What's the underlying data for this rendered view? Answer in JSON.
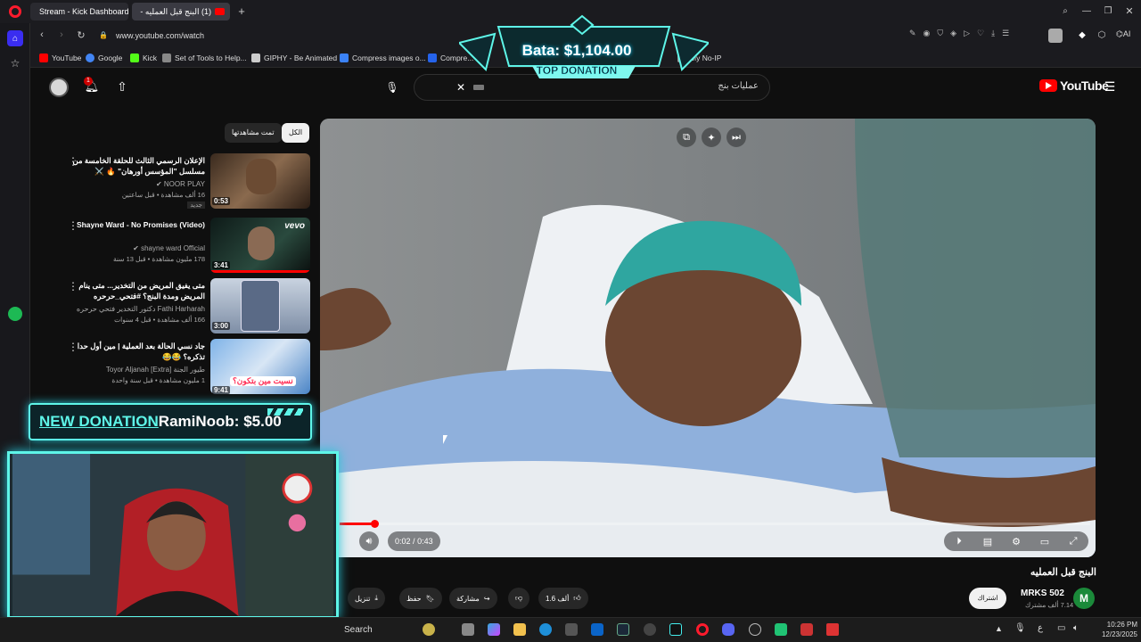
{
  "browser": {
    "tabs": [
      {
        "label": "Stream - Kick Dashboard"
      },
      {
        "label": "(1) البنج قبل العمليه -"
      }
    ],
    "url": "www.youtube.com/watch",
    "bookmarks": [
      {
        "label": "YouTube",
        "color": "#ff0000"
      },
      {
        "label": "Google",
        "color": "#4285f4"
      },
      {
        "label": "Kick",
        "color": "#53fc18"
      },
      {
        "label": "Set of Tools to Help...",
        "color": "#888888"
      },
      {
        "label": "GIPHY - Be Animated",
        "color": "#cccccc"
      },
      {
        "label": "Compress images o...",
        "color": "#3b82f6"
      },
      {
        "label": "Compre...",
        "color": "#2563eb"
      },
      {
        "label": "My No-IP",
        "color": "#999999"
      }
    ],
    "ai_label": "AI"
  },
  "youtube": {
    "search_query": "عمليات بنج",
    "logo_text": "YouTube",
    "notification_count": "1",
    "chips": {
      "all": "الكل",
      "watched": "تمت مشاهدتها"
    },
    "recommendations": [
      {
        "title": "الإعلان الرسمي الثالث للحلقة الخامسة من مسلسل \"المؤسس أورهان\" 🔥 ⚔️",
        "channel": "NOOR PLAY",
        "meta": "16 ألف مشاهدة • قبل ساعتين",
        "badge": "جديد",
        "duration": "0:53"
      },
      {
        "title": "Shayne Ward - No Promises (Video)",
        "channel": "shayne ward Official",
        "meta": "178 مليون مشاهدة • قبل 13 سنة",
        "duration": "3:41"
      },
      {
        "title": "متى يفيق المريض من التخدير... متى ينام المريض ومدة البنج؟ #فتحي_حرحره",
        "channel": "دكتور التخدير فتحي حرحره Fathi Harharah",
        "meta": "166 ألف مشاهدة • قبل 4 سنوات",
        "duration": "3:00"
      },
      {
        "title": "جاد نسي الحالة بعد العملية | مين أول حدا تذكره؟ 😂😂",
        "channel": "Toyor Aljanah [Extra] طيور الجنة",
        "meta": "1 مليون مشاهدة • قبل سنة واحدة",
        "duration": "9:41",
        "thumb_text": "نسيت مين بتكون؟"
      }
    ],
    "player": {
      "current_time": "0:02",
      "duration": "0:43",
      "time_separator": "/",
      "progress": 0.046
    },
    "video": {
      "title": "البنج قبل العمليه",
      "channel": "MRKS 502",
      "avatar_letter": "M",
      "subscribers": "7.14 ألف مشترك",
      "subscribe_label": "اشتراك",
      "likes": "1.6 ألف",
      "share_label": "مشاركة",
      "save_label": "حفظ",
      "download_label": "تنزيل"
    }
  },
  "overlays": {
    "top_donation": {
      "amount": "Bata: $1,104.00",
      "label": "TOP DONATION"
    },
    "new_donation": {
      "label": "NEW DONATION",
      "donor": "RamiNoob",
      "separator": ":",
      "amount": "$5.00"
    }
  },
  "taskbar": {
    "search_label": "Search",
    "time": "10:26 PM",
    "date": "12/23/2025",
    "lang": "ع"
  }
}
